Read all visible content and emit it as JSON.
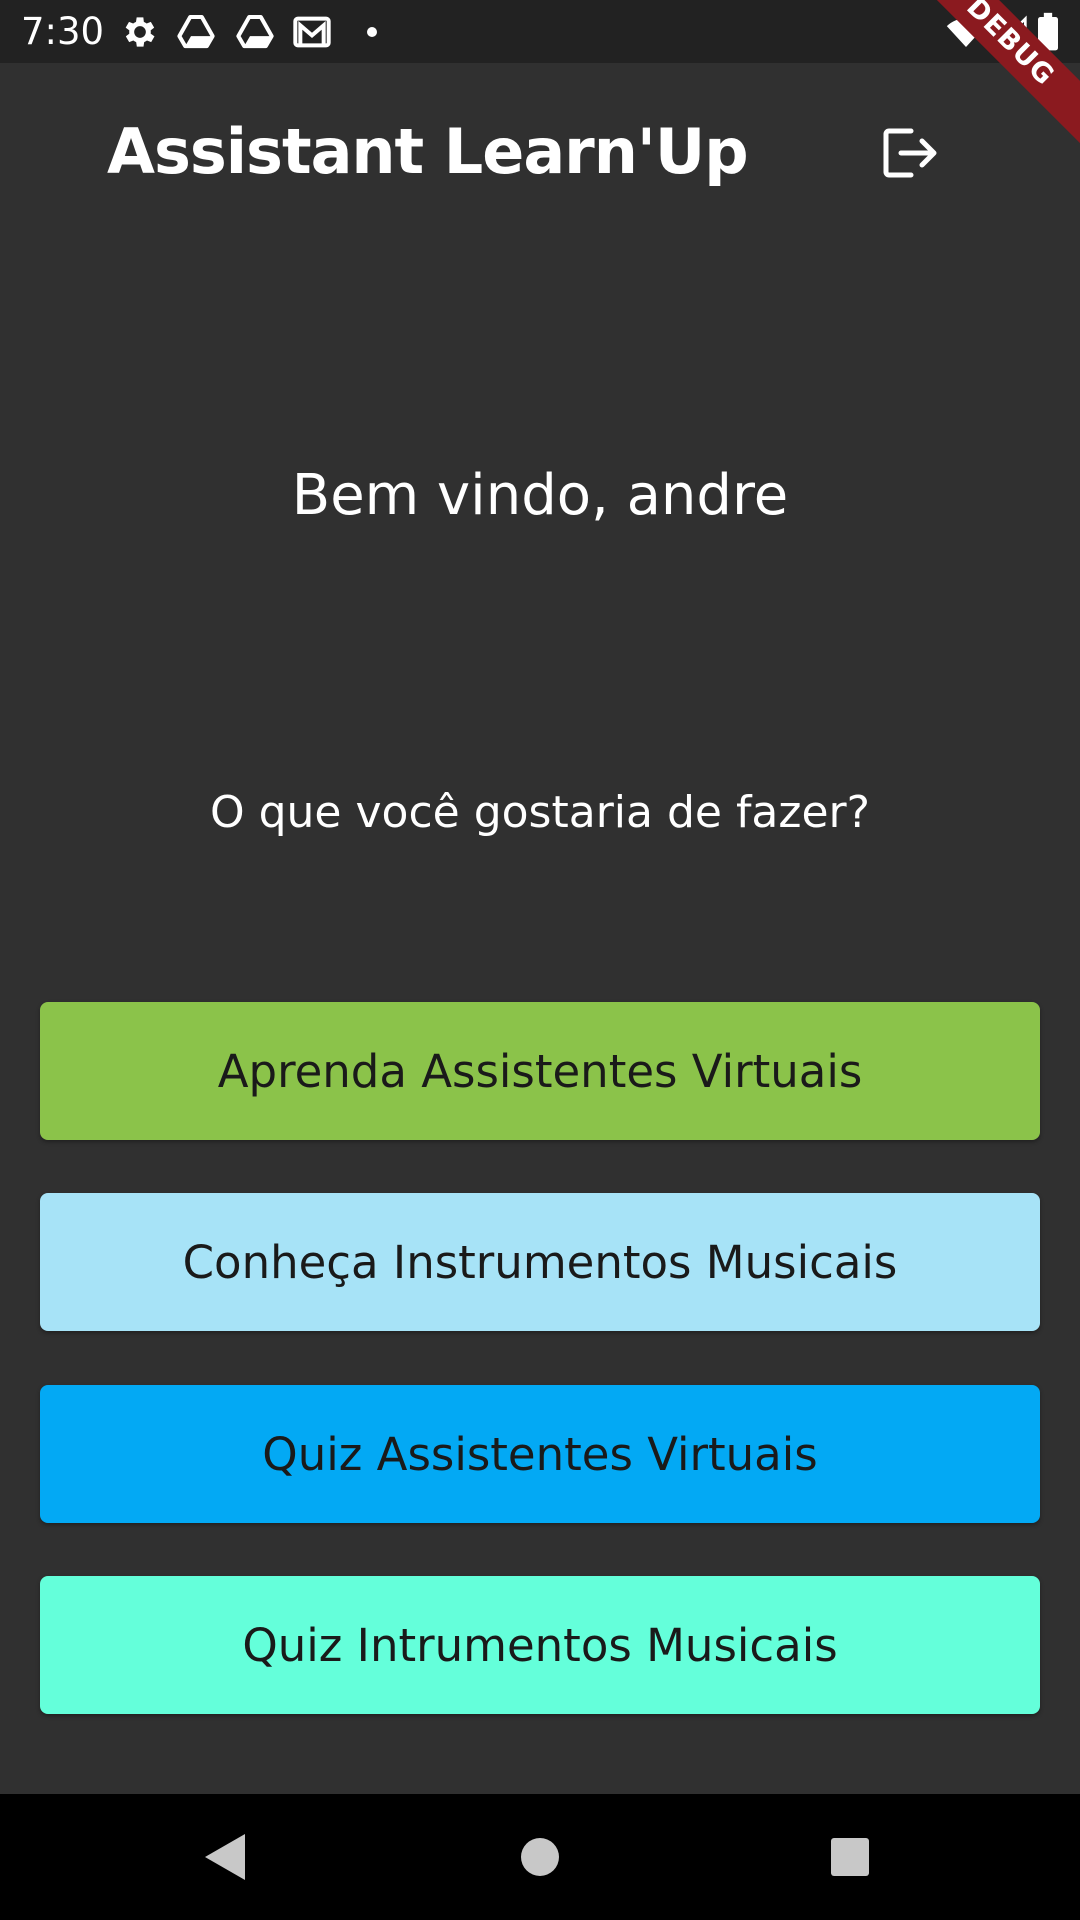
{
  "status_bar": {
    "time": "7:30",
    "left_icons": [
      "gear-icon",
      "drive-icon",
      "drive-icon",
      "gmail-icon",
      "dot-icon"
    ],
    "right_icons": [
      "wifi-icon",
      "cell-signal-icon",
      "battery-icon"
    ]
  },
  "debug_banner": "DEBUG",
  "app_bar": {
    "title": "Assistant Learn'Up",
    "action_icon": "logout-icon"
  },
  "main": {
    "welcome": "Bem vindo, andre",
    "question": "O que você gostaria de fazer?",
    "buttons": [
      {
        "label": "Aprenda Assistentes Virtuais",
        "color": "#8bc34a"
      },
      {
        "label": "Conheça Instrumentos Musicais",
        "color": "#a7e3f7"
      },
      {
        "label": "Quiz Assistentes Virtuais",
        "color": "#03a9f4"
      },
      {
        "label": "Quiz Intrumentos Musicais",
        "color": "#64ffda"
      }
    ]
  },
  "nav_bar": {
    "icons": [
      "back-icon",
      "home-icon",
      "recents-icon"
    ]
  },
  "colors": {
    "background": "#303030",
    "status_bar": "#222222",
    "nav_bar": "#000000",
    "debug_banner": "#8b1a1f"
  }
}
